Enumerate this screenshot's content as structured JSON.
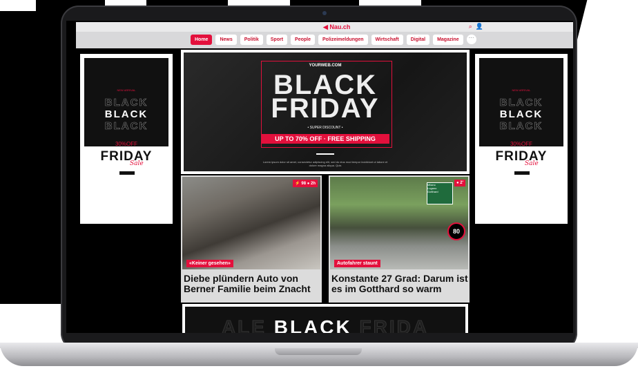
{
  "site": {
    "logo": "Nau.ch"
  },
  "header": {
    "icons": [
      "search-icon",
      "user-icon"
    ]
  },
  "nav": {
    "items": [
      {
        "label": "Home",
        "active": true
      },
      {
        "label": "News"
      },
      {
        "label": "Politik"
      },
      {
        "label": "Sport"
      },
      {
        "label": "People"
      },
      {
        "label": "Polizeimeldungen"
      },
      {
        "label": "Wirtschaft"
      },
      {
        "label": "Digital"
      },
      {
        "label": "Magazine"
      }
    ],
    "more": "···"
  },
  "main_ad": {
    "site": "YOURWEB.COM",
    "line1": "BLACK",
    "line2": "FRIDAY",
    "super": "• SUPER DISCOUNT •",
    "offer": "UP TO 70% OFF · FREE SHIPPING",
    "lorem": "Lorem ipsum dolor sit amet, consectetur adipiscing elit, sed do eius mod tempor incididunt ut labore et dolore magna aliqua. Quis"
  },
  "side_ad": {
    "tag": "NEW ARRIVAL",
    "black": "BLACK",
    "off": "30%OFF",
    "friday": "FRIDAY",
    "sale": "Sale"
  },
  "articles": [
    {
      "category": "«Keiner gesehen»",
      "stats": "⚡ 98  ● 2h",
      "headline": "Diebe plündern Auto von Berner Familie beim Znacht"
    },
    {
      "category": "Autofahrer staunt",
      "stats": "● 2'",
      "headline": "Konstante 27 Grad: Darum ist es im Gotthard so warm"
    }
  ],
  "road_sign": {
    "city1": "Milano",
    "city2": "Lugano",
    "city3": "Gotthard",
    "speed": "80"
  },
  "bottom_ad": {
    "left": "ALE",
    "mid": "BLACK",
    "right": "FRIDA"
  },
  "colors": {
    "brand": "#e3103c"
  }
}
